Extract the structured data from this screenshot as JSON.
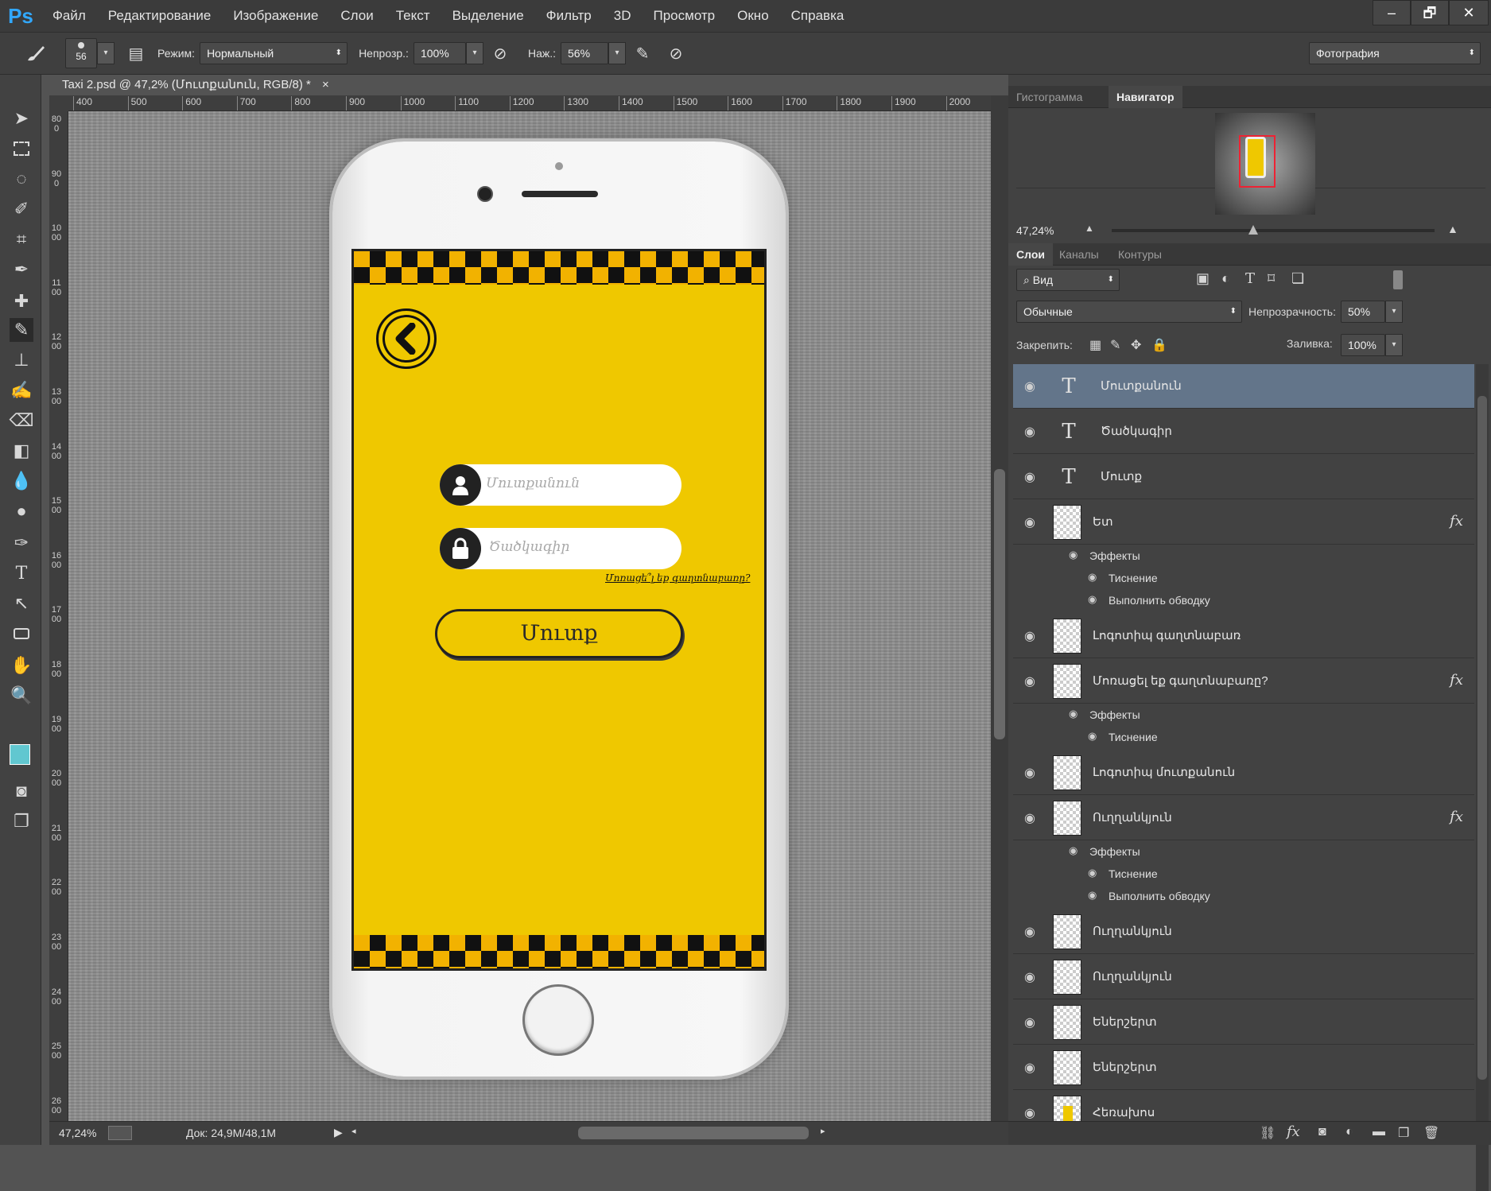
{
  "app": {
    "logo": "Ps"
  },
  "menu": [
    "Файл",
    "Редактирование",
    "Изображение",
    "Слои",
    "Текст",
    "Выделение",
    "Фильтр",
    "3D",
    "Просмотр",
    "Окно",
    "Справка"
  ],
  "window_controls": {
    "minimize": "–",
    "restore": "🗗",
    "close": "✕"
  },
  "options_bar": {
    "brush_size": "56",
    "mode_label": "Режим:",
    "mode_value": "Нормальный",
    "opacity_label": "Непрозр.:",
    "opacity_value": "100%",
    "pressure_label": "Наж.:",
    "pressure_value": "56%",
    "workspace": "Фотография"
  },
  "document": {
    "tab_title": "Taxi 2.psd @ 47,2% (Մուտքանուն, RGB/8) *",
    "close": "×",
    "ruler_top": [
      "400",
      "500",
      "600",
      "700",
      "800",
      "900",
      "1000",
      "1100",
      "1200",
      "1300",
      "1400",
      "1500",
      "1600",
      "1700",
      "1800",
      "1900",
      "2000"
    ],
    "ruler_left": [
      "800",
      "900",
      "1000",
      "1100",
      "1200",
      "1300",
      "1400",
      "1500",
      "1600",
      "1700",
      "1800",
      "1900",
      "2000",
      "2100",
      "2200",
      "2300",
      "2400",
      "2500",
      "2600"
    ]
  },
  "status": {
    "zoom": "47,24%",
    "doc": "Док: 24,9M/48,1M"
  },
  "app_screen": {
    "username_placeholder": "Մուտքանուն",
    "password_placeholder": "Ծածկագիր",
    "forgot": "Մոռացե՞լ եք գաղտնաբառը?",
    "login": "Մուտք",
    "screen_color": "#efc800"
  },
  "navigator": {
    "tabs": [
      "Гистограмма",
      "Навигатор"
    ],
    "zoom": "47,24%",
    "zoom_level": 0.47
  },
  "layers_panel": {
    "tabs": [
      "Слои",
      "Каналы",
      "Контуры"
    ],
    "filter": "Вид",
    "blend_mode": "Обычные",
    "opacity_label": "Непрозрачность:",
    "opacity_value": "50%",
    "lock_label": "Закрепить:",
    "fill_label": "Заливка:",
    "fill_value": "100%",
    "layers": [
      {
        "name": "Մուտքանուն",
        "kind": "text",
        "selected": true
      },
      {
        "name": "Ծածկագիր",
        "kind": "text"
      },
      {
        "name": "Մուտք",
        "kind": "text"
      },
      {
        "name": "Ետ",
        "kind": "pixel",
        "fx": true,
        "effects_label": "Эффекты",
        "effects": [
          "Тиснение",
          "Выполнить обводку"
        ]
      },
      {
        "name": "Լոգոտիպ գաղտնաբառ",
        "kind": "pixel"
      },
      {
        "name": "Մոռացել եք գաղտնաբառը?",
        "kind": "pixel",
        "fx": true,
        "effects_label": "Эффекты",
        "effects": [
          "Тиснение"
        ]
      },
      {
        "name": "Լոգոտիպ մուտքանուն",
        "kind": "pixel"
      },
      {
        "name": "Ուղղանկյուն",
        "kind": "shape",
        "fx": true,
        "effects_label": "Эффекты",
        "effects": [
          "Тиснение",
          "Выполнить обводку"
        ]
      },
      {
        "name": "Ուղղանկյուն",
        "kind": "shape"
      },
      {
        "name": "Ուղղանկյուն",
        "kind": "shape"
      },
      {
        "name": "Եներշերտ",
        "kind": "pixel"
      },
      {
        "name": "Եներշերտ",
        "kind": "pixel"
      },
      {
        "name": "Հեռախոս",
        "kind": "image"
      }
    ]
  }
}
